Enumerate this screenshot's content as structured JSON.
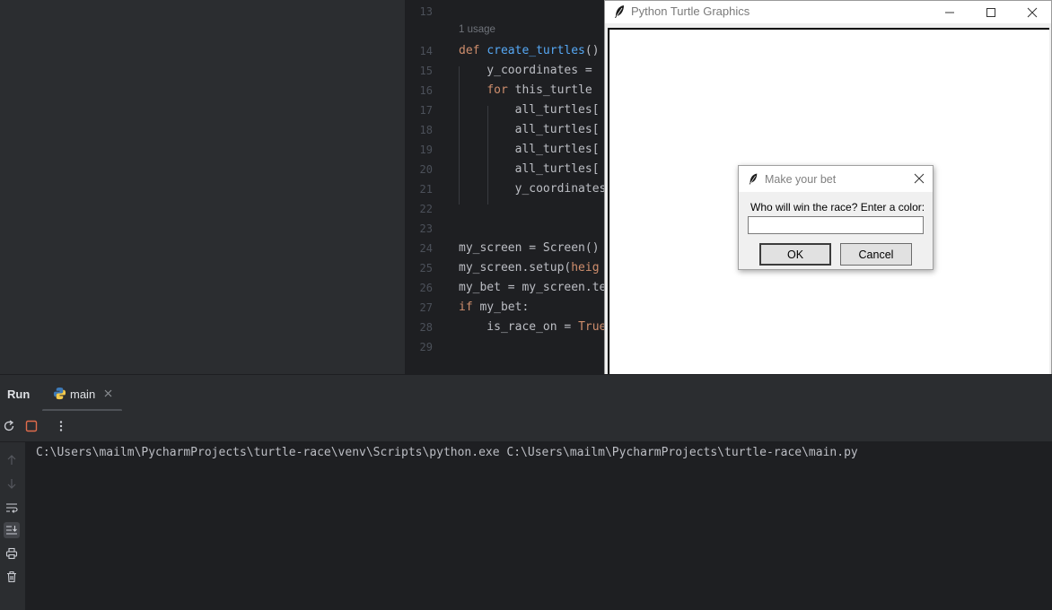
{
  "editor": {
    "usage_hint": "1 usage",
    "lines": [
      {
        "n": "13",
        "tokens": []
      },
      {
        "n": "14",
        "tokens": [
          [
            "kw",
            "def "
          ],
          [
            "fn",
            "create_turtles"
          ],
          [
            "t",
            "()"
          ]
        ]
      },
      {
        "n": "15",
        "tokens": [
          [
            "t",
            "    y_coordinates = "
          ]
        ]
      },
      {
        "n": "16",
        "tokens": [
          [
            "t",
            "    "
          ],
          [
            "kw",
            "for "
          ],
          [
            "t",
            "this_turtle "
          ]
        ]
      },
      {
        "n": "17",
        "tokens": [
          [
            "t",
            "        all_turtles["
          ]
        ]
      },
      {
        "n": "18",
        "tokens": [
          [
            "t",
            "        all_turtles["
          ]
        ]
      },
      {
        "n": "19",
        "tokens": [
          [
            "t",
            "        all_turtles["
          ]
        ]
      },
      {
        "n": "20",
        "tokens": [
          [
            "t",
            "        all_turtles["
          ]
        ]
      },
      {
        "n": "21",
        "tokens": [
          [
            "t",
            "        y_coordinates"
          ]
        ]
      },
      {
        "n": "22",
        "tokens": []
      },
      {
        "n": "23",
        "tokens": []
      },
      {
        "n": "24",
        "tokens": [
          [
            "t",
            "my_screen = Screen()"
          ]
        ]
      },
      {
        "n": "25",
        "tokens": [
          [
            "t",
            "my_screen.setup("
          ],
          [
            "num",
            "heig"
          ]
        ]
      },
      {
        "n": "26",
        "tokens": [
          [
            "t",
            "my_bet = my_screen.te"
          ]
        ]
      },
      {
        "n": "27",
        "tokens": [
          [
            "kw",
            "if "
          ],
          [
            "t",
            "my_bet:"
          ]
        ]
      },
      {
        "n": "28",
        "tokens": [
          [
            "t",
            "    is_race_on = "
          ],
          [
            "kw",
            "True"
          ]
        ]
      },
      {
        "n": "29",
        "tokens": []
      }
    ]
  },
  "turtle_window": {
    "title": "Python Turtle Graphics"
  },
  "dialog": {
    "title": "Make your bet",
    "prompt": "Who will win the race? Enter a color:",
    "input_value": "",
    "ok_label": "OK",
    "cancel_label": "Cancel"
  },
  "run_panel": {
    "title": "Run",
    "tab_label": "main",
    "console_output": "C:\\Users\\mailm\\PycharmProjects\\turtle-race\\venv\\Scripts\\python.exe C:\\Users\\mailm\\PycharmProjects\\turtle-race\\main.py"
  },
  "colors": {
    "editor_bg": "#1e1f22",
    "panel_bg": "#2b2d30",
    "keyword": "#cf8e6d",
    "function": "#56a8f5",
    "text": "#bcbec4",
    "stop_icon": "#e06c4c"
  },
  "icons": {
    "rerun": "rerun-icon",
    "stop": "stop-icon",
    "more": "more-options-icon",
    "up": "arrow-up-icon",
    "down": "arrow-down-icon",
    "wrap": "soft-wrap-icon",
    "scroll_end": "scroll-to-end-icon",
    "print": "print-icon",
    "trash": "trash-icon"
  }
}
